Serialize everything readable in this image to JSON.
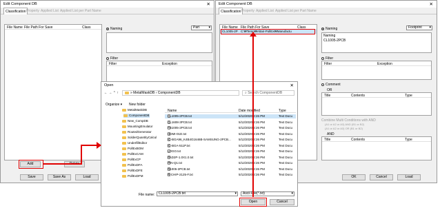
{
  "left_window": {
    "title": "Edit Component DB",
    "tabs": [
      "Classification",
      "Property",
      "Applied List",
      "Applied List per Part Name"
    ],
    "list_headers": [
      "File Name",
      "File Path For Save",
      "Class"
    ],
    "naming_label": "Naming",
    "naming_type": "Part",
    "filter_label": "Filter",
    "filter_headers": [
      "Filter",
      "Exception"
    ],
    "add": "Add",
    "delete": "Delete",
    "save": "Save",
    "save_as": "Save As",
    "load": "Load"
  },
  "right_window": {
    "title": "Edit Component DB",
    "tabs": [
      "Classification",
      "Property",
      "Applied List",
      "Applied List per Part Name"
    ],
    "list_headers": [
      "File Name",
      "File Path For Save",
      "Class"
    ],
    "row": {
      "name": "CL1005-2P",
      "path": "C:₩Temp₩Altair-PollEx₩Manufactu"
    },
    "naming_label": "Naming",
    "naming_type": "Footprint",
    "naming_section": "Naming",
    "naming_value": "CL1005-2PCB",
    "filter_label": "Filter",
    "filter_headers": [
      "Filter",
      "Exception"
    ],
    "comment_label": "Comment",
    "or_label": "OR",
    "comment_headers": [
      "Title",
      "Contents",
      "Type"
    ],
    "combine_label": "Combine Multi Conditions with AND",
    "combine_opt1": "(A1 or A2 or A3) AND (B1 or B2)",
    "combine_opt2": "(A1 or A2 or A3) OR (B1 or B2)",
    "and_label": "AND",
    "and_headers": [
      "Title",
      "Contents",
      "Type"
    ],
    "ok": "OK",
    "cancel": "Cancel",
    "load": "Load"
  },
  "open_dialog": {
    "title": "Open",
    "breadcrumb": [
      "MetalMaskDB",
      "ComponentDB"
    ],
    "search_placeholder": "Search ComponentDB",
    "organize": "Organize ▾",
    "new_folder": "New folder",
    "tree": [
      "MetalMaskDB",
      "ComponentDB",
      "New_CompDB",
      "MountingEmulator",
      "RoutedGenerator",
      "SolderQuantityCalcul",
      "UnderfillEditor",
      "PollExBOM",
      "PollExCAM",
      "PollExCP",
      "PollExDFA",
      "PollExDFE",
      "PollExDFM"
    ],
    "col_headers": [
      "Name",
      "Date modified",
      "Type"
    ],
    "files": [
      {
        "name": "CL1005-2PCB.txt",
        "date": "5/12/2020 2:26 PM",
        "type": "Text Docu"
      },
      {
        "name": "CL1608-3PCB.txt",
        "date": "5/12/2020 2:26 PM",
        "type": "Text Docu"
      },
      {
        "name": "FB1005-2PCB.txt",
        "date": "5/12/2020 2:26 PM",
        "type": "Text Docu"
      },
      {
        "name": "HDMI-01D.txt",
        "date": "5/12/2020 2:26 PM",
        "type": "Text Docu"
      },
      {
        "name": "IC-BGA96_K4B4G1646B-SAMSUNG-2PCB...",
        "date": "5/12/2020 2:26 PM",
        "type": "Text Docu"
      },
      {
        "name": "IC-BGA-511P.txt",
        "date": "5/12/2020 2:26 PM",
        "type": "Text Docu"
      },
      {
        "name": "LOGO.txt",
        "date": "5/12/2020 2:26 PM",
        "type": "Text Docu"
      },
      {
        "name": "PAD2P-1.0X1.0.txt",
        "date": "5/12/2020 2:26 PM",
        "type": "Text Docu"
      },
      {
        "name": "PIN-Q1.txt",
        "date": "5/12/2020 2:26 PM",
        "type": "Text Docu"
      },
      {
        "name": "R1005-2PCB.txt",
        "date": "5/12/2020 2:26 PM",
        "type": "Text Docu"
      },
      {
        "name": "R-CHIP-2125-F.txt",
        "date": "5/12/2020 2:26 PM",
        "type": "Text Docu"
      }
    ],
    "file_name_label": "File name:",
    "file_name_value": "CL1005-2PCB.txt",
    "file_type": "Ascii File(*.txt)",
    "open": "Open",
    "cancel": "Cancel"
  }
}
